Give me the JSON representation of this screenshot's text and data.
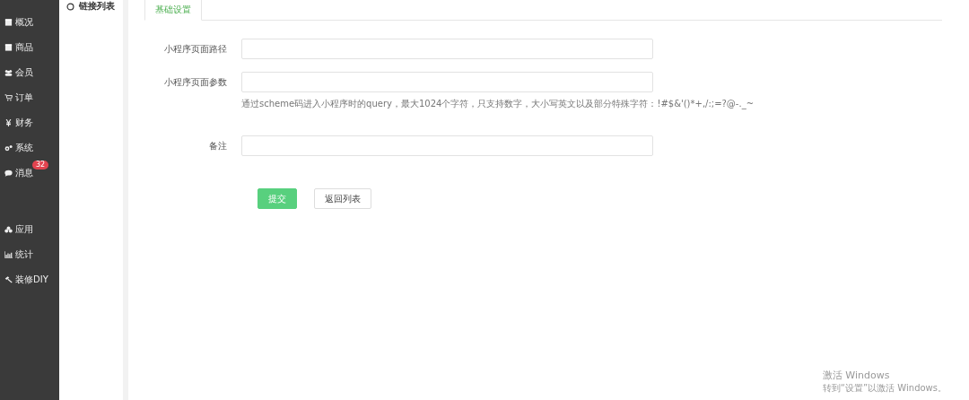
{
  "sidebar": {
    "sections": [
      {
        "items": [
          {
            "label": "概况",
            "kind": "square",
            "selected": false
          },
          {
            "label": "商品",
            "kind": "square",
            "selected": false
          },
          {
            "label": "会员",
            "kind": "users",
            "selected": false
          },
          {
            "label": "订单",
            "kind": "cart",
            "selected": false
          },
          {
            "label": "财务",
            "kind": "yen",
            "selected": false
          },
          {
            "label": "系统",
            "kind": "gears",
            "selected": false
          },
          {
            "label": "消息",
            "kind": "chat",
            "selected": false,
            "badge": "32"
          }
        ]
      },
      {
        "items": [
          {
            "label": "应用",
            "kind": "cubes",
            "selected": false
          },
          {
            "label": "统计",
            "kind": "chart",
            "selected": false
          },
          {
            "label": "装修DIY",
            "kind": "hammer",
            "selected": false
          }
        ]
      }
    ]
  },
  "subnav": {
    "items": [
      {
        "label": "链接列表",
        "selected": false
      }
    ]
  },
  "tabs": [
    {
      "label": "基础设置",
      "selected": true
    }
  ],
  "form": {
    "fields": [
      {
        "label": "小程序页面路径"
      },
      {
        "label": "小程序页面参数",
        "hint": "通过scheme码进入小程序时的query，最大1024个字符，只支持数字，大小写英文以及部分特殊字符：!#$&'()*+,/:;=?@-._~"
      },
      {
        "label": "备注"
      }
    ],
    "buttons": [
      {
        "label": "提交",
        "kind": "primary"
      },
      {
        "label": "返回列表",
        "kind": "default"
      }
    ]
  },
  "activation": {
    "title": "激活 Windows",
    "subtitle": "转到“设置”以激活 Windows。"
  }
}
